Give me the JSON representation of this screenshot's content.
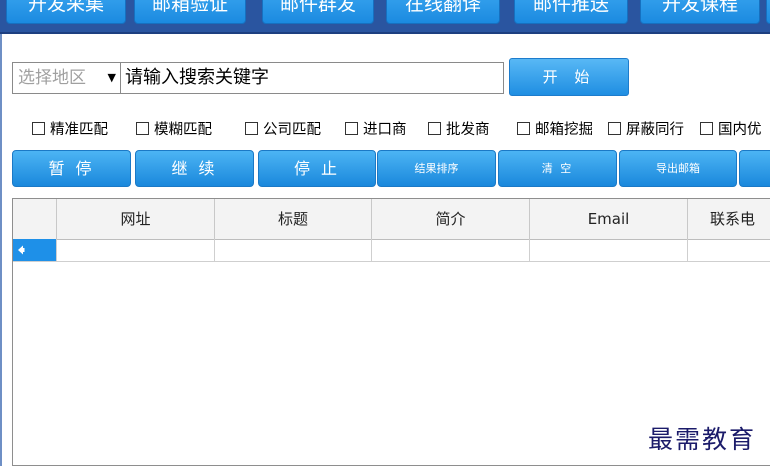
{
  "top_tabs": [
    "开发采集",
    "邮箱验证",
    "邮件群发",
    "在线翻译",
    "邮件推送",
    "开发课程"
  ],
  "search": {
    "region_placeholder": "选择地区",
    "keyword_value": "请输入搜索关键字",
    "start_label": "开  始"
  },
  "options": [
    "精准匹配",
    "模糊匹配",
    "公司匹配",
    "进口商",
    "批发商",
    "邮箱挖掘",
    "屏蔽同行",
    "国内优"
  ],
  "actions": [
    "暂 停",
    "继 续",
    "停 止",
    "结果排序",
    "清 空",
    "导出邮箱"
  ],
  "table": {
    "columns": [
      "网址",
      "标题",
      "简介",
      "Email",
      "联系电"
    ]
  },
  "watermark": "最需教育",
  "colors": {
    "accent": "#1e90e8",
    "topbar": "#2a55a0"
  }
}
